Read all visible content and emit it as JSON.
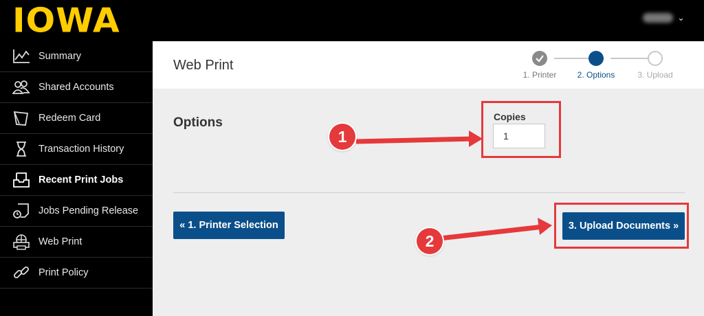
{
  "brand": {
    "logo_text": "IOWA",
    "color": "#ffcd00"
  },
  "user_menu": {
    "chevron": "⌄"
  },
  "sidebar": {
    "items": [
      {
        "label": "Summary",
        "icon": "chart-line-icon"
      },
      {
        "label": "Shared Accounts",
        "icon": "users-icon"
      },
      {
        "label": "Redeem Card",
        "icon": "card-icon"
      },
      {
        "label": "Transaction History",
        "icon": "hourglass-icon"
      },
      {
        "label": "Recent Print Jobs",
        "icon": "inbox-tray-icon",
        "active": true
      },
      {
        "label": "Jobs Pending Release",
        "icon": "document-clock-icon"
      },
      {
        "label": "Web Print",
        "icon": "globe-printer-icon"
      },
      {
        "label": "Print Policy",
        "icon": "link-icon"
      }
    ]
  },
  "header": {
    "title": "Web Print"
  },
  "stepper": {
    "steps": [
      {
        "label": "1. Printer",
        "state": "complete"
      },
      {
        "label": "2. Options",
        "state": "active"
      },
      {
        "label": "3. Upload",
        "state": "pending"
      }
    ]
  },
  "options": {
    "section_title": "Options",
    "copies_label": "Copies",
    "copies_value": "1"
  },
  "buttons": {
    "back_label": "« 1. Printer Selection",
    "next_label": "3. Upload Documents »"
  },
  "annotations": {
    "badge1": "1",
    "badge2": "2",
    "color": "#e5393b"
  },
  "colors": {
    "primary": "#0b4f8a",
    "step_complete": "#8a8a8a"
  }
}
